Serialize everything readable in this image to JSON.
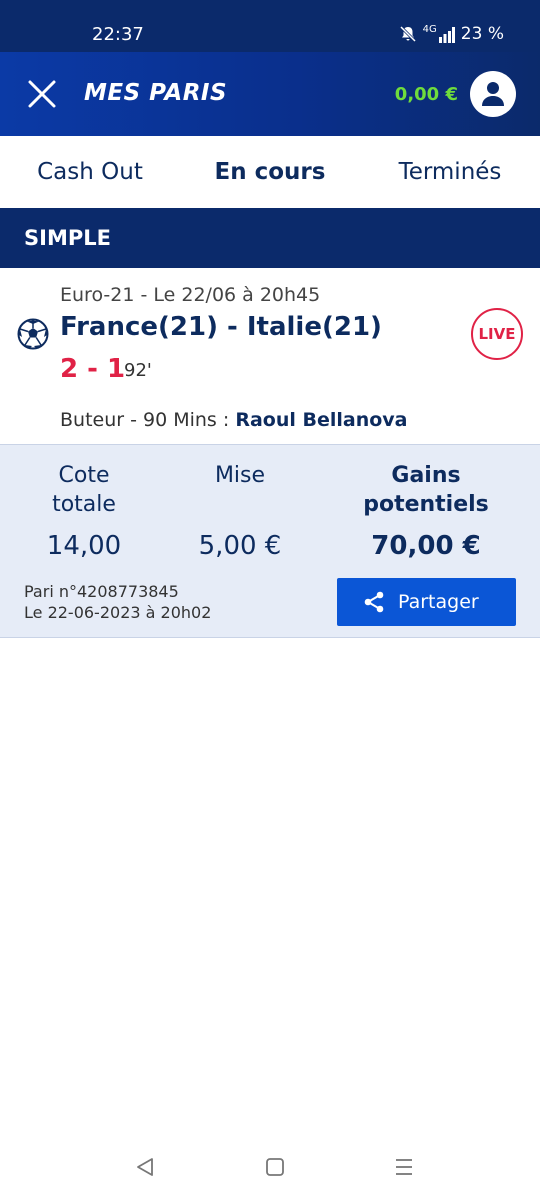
{
  "status_bar": {
    "time": "22:37",
    "network": "4G",
    "battery": "23 %"
  },
  "header": {
    "title": "MES PARIS",
    "balance": "0,00 €"
  },
  "tabs": [
    {
      "label": "Cash Out",
      "active": false
    },
    {
      "label": "En cours",
      "active": true
    },
    {
      "label": "Terminés",
      "active": false
    }
  ],
  "section": {
    "title": "SIMPLE"
  },
  "bet": {
    "event_meta": "Euro-21 - Le 22/06 à 20h45",
    "match": "France(21) - Italie(21)",
    "live_label": "LIVE",
    "score": "2 - 1",
    "minute": "92'",
    "market_label": "Buteur - 90 Mins : ",
    "selection": "Raoul Bellanova"
  },
  "summary": {
    "odds_label_line1": "Cote",
    "odds_label_line2": "totale",
    "odds_value": "14,00",
    "stake_label": "Mise",
    "stake_value": "5,00 €",
    "gains_label_line1": "Gains",
    "gains_label_line2": "potentiels",
    "gains_value": "70,00 €",
    "bet_number": "Pari n°4208773845",
    "bet_date": "Le 22-06-2023 à 20h02",
    "share_label": "Partager"
  },
  "colors": {
    "navy": "#0b2a6b",
    "accent_blue": "#0b56d6",
    "live_red": "#e02246",
    "balance_green": "#6fdc3c",
    "panel_bg": "#e6ecf7"
  },
  "icons": [
    "close-icon",
    "user-icon",
    "soccer-ball-icon",
    "share-icon",
    "back-icon",
    "home-icon",
    "recents-icon",
    "mute-icon",
    "signal-icon"
  ]
}
